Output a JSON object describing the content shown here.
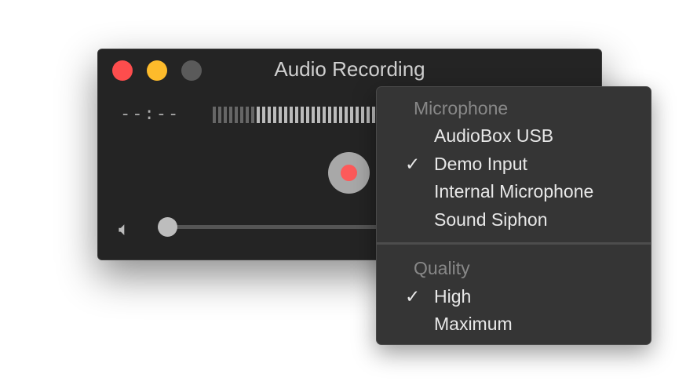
{
  "window": {
    "title": "Audio Recording",
    "time": "--:--",
    "meter_level": 0.3,
    "volume": 0.0
  },
  "menu": {
    "microphone_header": "Microphone",
    "microphones": [
      {
        "label": "AudioBox USB",
        "checked": false
      },
      {
        "label": "Demo Input",
        "checked": true
      },
      {
        "label": "Internal Microphone",
        "checked": false
      },
      {
        "label": "Sound Siphon",
        "checked": false
      }
    ],
    "quality_header": "Quality",
    "qualities": [
      {
        "label": "High",
        "checked": true
      },
      {
        "label": "Maximum",
        "checked": false
      }
    ],
    "check": "✓"
  },
  "colors": {
    "close": "#fd4d4d",
    "minimize": "#fdbb2b",
    "zoom": "#5a5a5a",
    "record": "#fd5a5a"
  }
}
